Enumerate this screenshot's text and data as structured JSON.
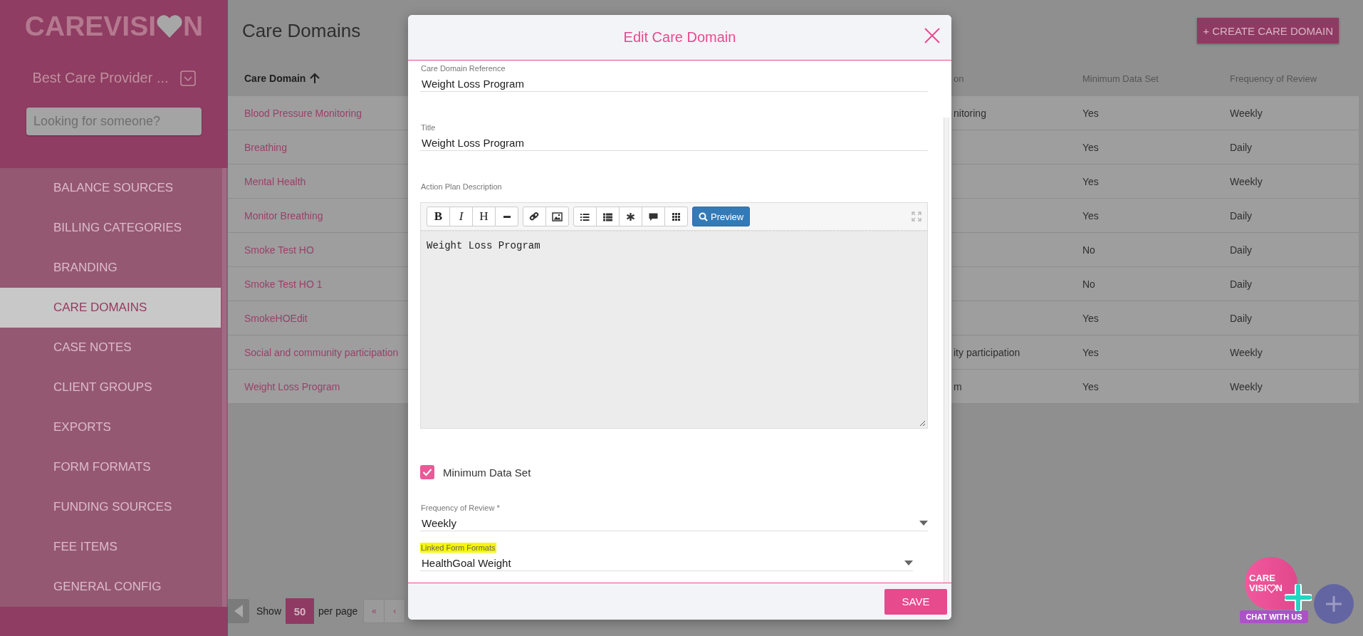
{
  "sidebar": {
    "logo_start": "CAREVISI",
    "logo_end": "N",
    "provider": "Best Care Provider ...",
    "search": {
      "placeholder": "Looking for someone?"
    },
    "items": [
      {
        "label": "BALANCE SOURCES",
        "selected": false
      },
      {
        "label": "BILLING CATEGORIES",
        "selected": false
      },
      {
        "label": "BRANDING",
        "selected": false
      },
      {
        "label": "CARE DOMAINS",
        "selected": true
      },
      {
        "label": "CASE NOTES",
        "selected": false
      },
      {
        "label": "CLIENT GROUPS",
        "selected": false
      },
      {
        "label": "EXPORTS",
        "selected": false
      },
      {
        "label": "FORM FORMATS",
        "selected": false
      },
      {
        "label": "FUNDING SOURCES",
        "selected": false
      },
      {
        "label": "FEE ITEMS",
        "selected": false
      },
      {
        "label": "GENERAL CONFIG",
        "selected": false
      }
    ]
  },
  "page": {
    "title": "Care Domains",
    "create_button": "+ CREATE CARE DOMAIN",
    "table": {
      "columns": [
        {
          "label": "Care Domain",
          "sorted": true
        },
        {
          "label": "on",
          "sorted": false
        },
        {
          "label": "Minimum Data Set",
          "sorted": false
        },
        {
          "label": "Frequency of Review",
          "sorted": false
        }
      ],
      "rows": [
        {
          "care_domain": "Blood Pressure Monitoring",
          "column_2": "nitoring",
          "minimum_data_set": "Yes",
          "frequency_of_review": "Weekly"
        },
        {
          "care_domain": "Breathing",
          "minimum_data_set": "Yes",
          "frequency_of_review": "Daily"
        },
        {
          "care_domain": "Mental Health",
          "minimum_data_set": "Yes",
          "frequency_of_review": "Weekly"
        },
        {
          "care_domain": "Monitor Breathing",
          "minimum_data_set": "Yes",
          "frequency_of_review": "Daily"
        },
        {
          "care_domain": "Smoke Test HO",
          "minimum_data_set": "No",
          "frequency_of_review": "Daily"
        },
        {
          "care_domain": "Smoke Test HO 1",
          "minimum_data_set": "No",
          "frequency_of_review": "Daily"
        },
        {
          "care_domain": "SmokeHOEdit",
          "minimum_data_set": "Yes",
          "frequency_of_review": "Daily"
        },
        {
          "care_domain": "Social and community participation",
          "column_2": "ity participation",
          "minimum_data_set": "Yes",
          "frequency_of_review": "Weekly"
        },
        {
          "care_domain": "Weight Loss Program",
          "column_2": "m",
          "minimum_data_set": "Yes",
          "frequency_of_review": "Weekly"
        }
      ]
    },
    "pagination": {
      "show_label": "Show",
      "per_page": "50",
      "per_page_label": "per page",
      "buttons": [
        "«",
        "‹"
      ]
    }
  },
  "modal": {
    "title": "Edit Care Domain",
    "fields": [
      {
        "kind": "text",
        "label": "Care Domain Reference",
        "value": "Weight Loss Program"
      },
      {
        "kind": "text",
        "label": "Title",
        "value": "Weight Loss Program"
      },
      {
        "kind": "editor",
        "label": "Action Plan Description",
        "value": "Weight Loss Program",
        "toolbar": [
          [
            {
              "kind": "bold",
              "label": "B"
            },
            {
              "kind": "italic",
              "label": "I"
            },
            {
              "kind": "heading",
              "label": "H"
            },
            {
              "kind": "rule"
            }
          ],
          [
            {
              "kind": "link"
            },
            {
              "kind": "image"
            }
          ],
          [
            {
              "kind": "bullets"
            },
            {
              "kind": "numbered"
            },
            {
              "kind": "asterisk"
            },
            {
              "kind": "comment"
            },
            {
              "kind": "grid"
            }
          ],
          [
            {
              "kind": "preview",
              "label": "Preview"
            }
          ]
        ]
      },
      {
        "kind": "checkbox",
        "label": "Minimum Data Set",
        "checked": true
      },
      {
        "kind": "select",
        "label": "Frequency of Review *",
        "value": "Weekly",
        "highlighted": false
      },
      {
        "kind": "select",
        "label": "Linked Form Formats",
        "value": "HealthGoal Weight",
        "highlighted": true
      }
    ],
    "save_button": "SAVE"
  },
  "chat": {
    "logo_top": "CARE",
    "logo_start": "VISI",
    "logo_end": "N",
    "label": "CHAT WITH US"
  }
}
